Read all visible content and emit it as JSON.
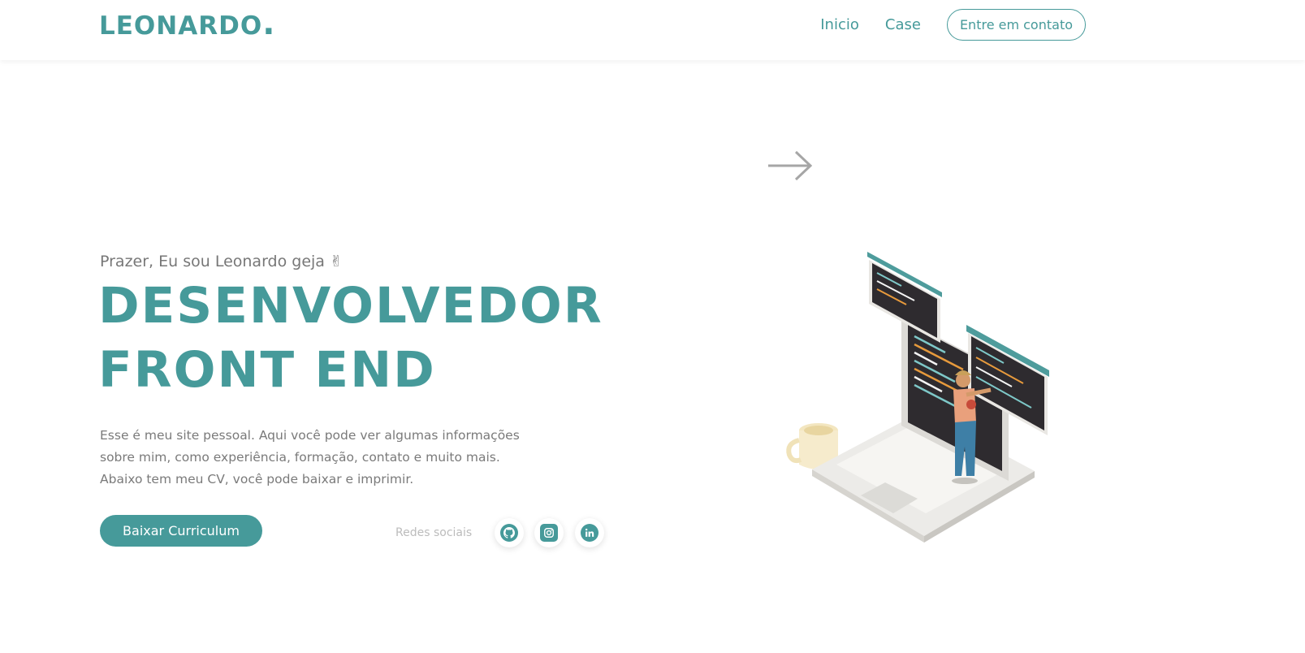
{
  "header": {
    "logo_text": "LEONARDO",
    "logo_dot": ".",
    "nav": [
      {
        "label": "Inicio"
      },
      {
        "label": "Case"
      }
    ],
    "contact_label": "Entre em contato"
  },
  "hero": {
    "intro": "Prazer, Eu sou Leonardo geja ✌",
    "title_line1": "DESENVOLVEDOR",
    "title_line2": "FRONT END",
    "desc_line1": "Esse é meu site pessoal. Aqui você pode ver algumas informações",
    "desc_line2": "sobre mim, como experiência, formação, contato e muito mais.",
    "desc_line3": "Abaixo tem meu CV, você pode baixar e imprimir.",
    "cv_button": "Baixar Curriculum",
    "social_label": "Redes sociais",
    "social_icons": [
      "github-icon",
      "instagram-icon",
      "linkedin-icon"
    ]
  },
  "colors": {
    "accent": "#469a9a",
    "text": "#777777",
    "muted": "#bcbcbc"
  }
}
